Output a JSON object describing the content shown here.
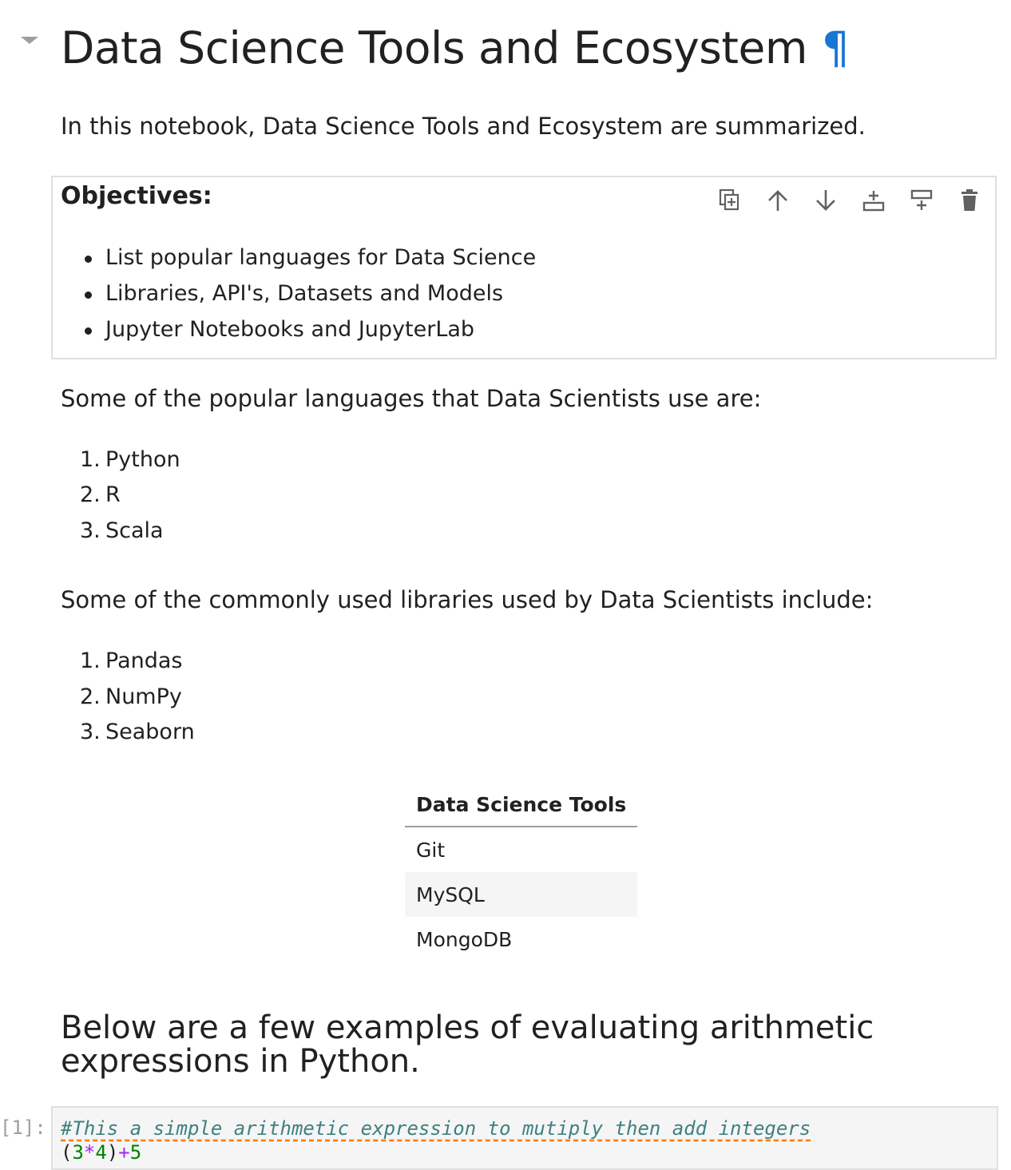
{
  "title": "Data Science Tools and Ecosystem",
  "anchor_symbol": "¶",
  "intro": "In this notebook, Data Science Tools and Ecosystem are summarized.",
  "objectives": {
    "heading": "Objectives:",
    "items": [
      "List popular languages for Data Science",
      "Libraries, API's, Datasets and Models",
      "Jupyter Notebooks and JupyterLab"
    ]
  },
  "cell_toolbar": {
    "icons": [
      "duplicate-icon",
      "move-up-icon",
      "move-down-icon",
      "insert-below-icon",
      "insert-above-icon",
      "delete-icon"
    ]
  },
  "languages": {
    "intro": "Some of the popular languages that Data Scientists use are:",
    "items": [
      {
        "n": "1.",
        "label": "Python"
      },
      {
        "n": "2.",
        "label": "R"
      },
      {
        "n": "3.",
        "label": "Scala"
      }
    ]
  },
  "libraries": {
    "intro": "Some of the commonly used libraries used by Data Scientists include:",
    "items": [
      {
        "n": "1.",
        "label": "Pandas"
      },
      {
        "n": "2.",
        "label": "NumPy"
      },
      {
        "n": "3.",
        "label": "Seaborn"
      }
    ]
  },
  "tools_table": {
    "header": "Data Science Tools",
    "rows": [
      "Git",
      "MySQL",
      "MongoDB"
    ]
  },
  "examples_heading": "Below are a few examples of evaluating arithmetic expressions in Python.",
  "code_cell": {
    "prompt": "[1]:",
    "comment": "#This a simple arithmetic expression to mutiply then add integers",
    "tokens": [
      "(",
      "3",
      "*",
      "4",
      ")",
      "+",
      "5"
    ]
  },
  "colors": {
    "anchor": "#1976d2",
    "comment": "#408080",
    "number": "#008000",
    "operator": "#aa22ff",
    "spellcheck_underline": "#f57c00"
  }
}
